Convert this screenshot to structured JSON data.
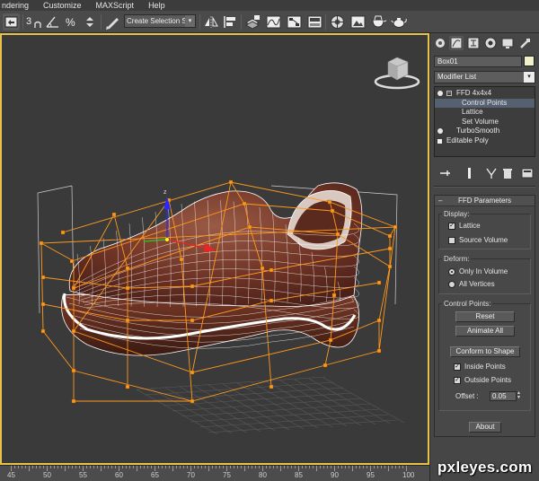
{
  "menu": {
    "items": [
      "ndering",
      "Customize",
      "MAXScript",
      "Help"
    ]
  },
  "toolbar": {
    "selection_set": "Create Selection Se",
    "snap_label": "3",
    "icons": [
      "undo-icon",
      "snap-toggle-icon",
      "angle-snap-icon",
      "percent-snap-icon",
      "spinner-snap-icon",
      "edit-named-selection-icon",
      "mirror-icon",
      "align-icon",
      "layer-manager-icon",
      "curve-editor-icon",
      "schematic-view-icon",
      "material-editor-icon",
      "render-setup-icon",
      "rendered-frame-icon",
      "quick-render-icon"
    ]
  },
  "viewport": {
    "viewcube_label": "",
    "accent_color": "#e7c34a",
    "lattice_color": "#ff9a1e",
    "shoe_color": "#7a3a28"
  },
  "timeline": {
    "labels": [
      "45",
      "50",
      "55",
      "60",
      "65",
      "70",
      "75",
      "80",
      "85",
      "90",
      "95",
      "100"
    ]
  },
  "command_panel": {
    "tabs": [
      "create-tab-icon",
      "modify-tab-icon",
      "hierarchy-tab-icon",
      "motion-tab-icon",
      "display-tab-icon",
      "utilities-tab-icon"
    ],
    "object_name": "Box01",
    "object_color": "#f2f0c9",
    "modifier_list": "Modifier List",
    "stack": [
      {
        "label": "FFD 4x4x4",
        "type": "modifier",
        "expanded": true
      },
      {
        "label": "Control Points",
        "type": "sub",
        "selected": true
      },
      {
        "label": "Lattice",
        "type": "sub"
      },
      {
        "label": "Set Volume",
        "type": "sub"
      },
      {
        "label": "TurboSmooth",
        "type": "modifier"
      },
      {
        "label": "Editable Poly",
        "type": "base"
      }
    ],
    "ffd": {
      "title": "FFD Parameters",
      "display_group": "Display:",
      "lattice": "Lattice",
      "source_volume": "Source Volume",
      "lattice_checked": true,
      "source_volume_checked": false,
      "deform_group": "Deform:",
      "only_in_volume": "Only In Volume",
      "all_vertices": "All Vertices",
      "deform_selected": "only_in_volume",
      "control_points_group": "Control Points:",
      "reset": "Reset",
      "animate_all": "Animate All",
      "conform": "Conform to Shape",
      "inside_points": "Inside Points",
      "outside_points": "Outside Points",
      "inside_checked": true,
      "outside_checked": true,
      "offset_label": "Offset :",
      "offset_value": "0.05",
      "about": "About"
    }
  },
  "watermark": "pxleyes.com"
}
